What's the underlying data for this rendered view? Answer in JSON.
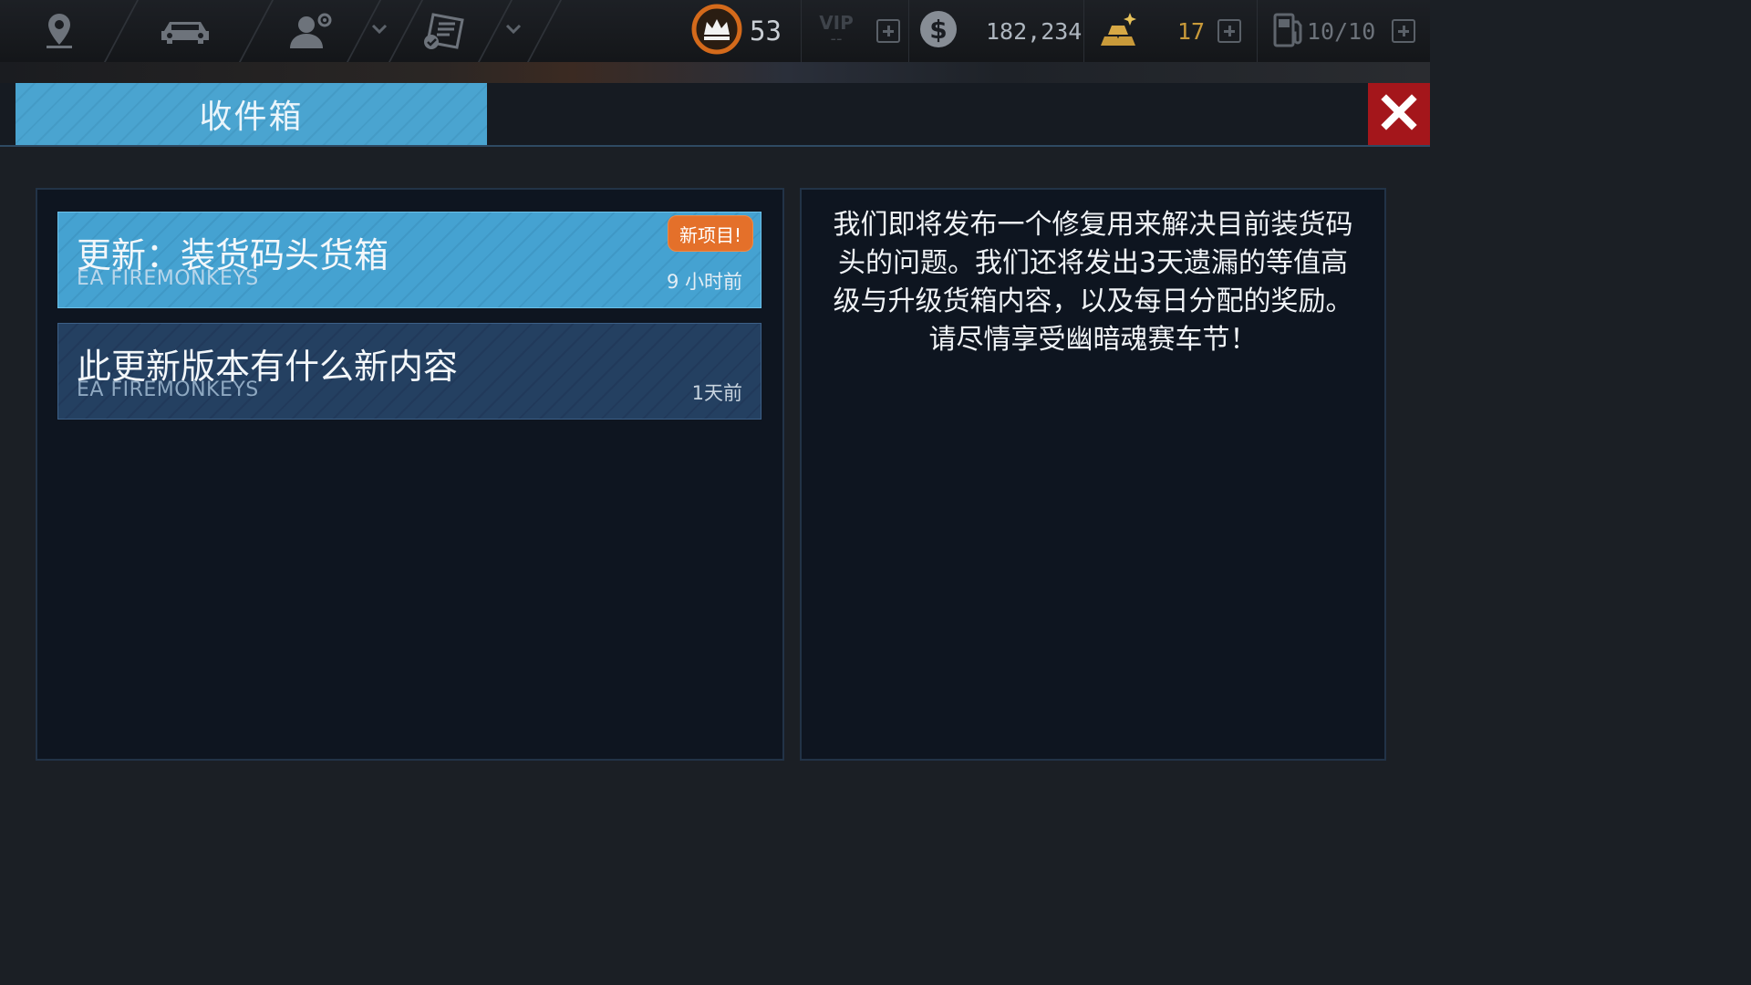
{
  "topbar": {
    "nav_icons": [
      "location-pin-icon",
      "car-icon",
      "profile-settings-icon",
      "checklist-icon"
    ],
    "rank": {
      "icon": "crown-icon",
      "value": "53"
    },
    "vip": {
      "label": "VIP",
      "value": "--"
    },
    "cash": {
      "icon": "dollar-coin-icon",
      "value": "182,234"
    },
    "gold": {
      "icon": "gold-bars-icon",
      "value": "17"
    },
    "fuel": {
      "icon": "fuel-pump-icon",
      "value": "10/10"
    }
  },
  "header": {
    "tab_label": "收件箱",
    "close_icon": "close-x-icon",
    "close_color": "#a4161b"
  },
  "messages": [
    {
      "title": "更新：装货码头货箱",
      "sender": "EA FIREMONKEYS",
      "time": "9 小时前",
      "badge": "新项目!",
      "selected": true
    },
    {
      "title": "此更新版本有什么新内容",
      "sender": "EA FIREMONKEYS",
      "time": "1天前",
      "badge": "",
      "selected": false
    }
  ],
  "detail": {
    "body": "我们即将发布一个修复用来解决目前装货码头的问题。我们还将发出3天遗漏的等值高级与升级货箱内容，以及每日分配的奖励。请尽情享受幽暗魂赛车节！"
  },
  "colors": {
    "accent_blue": "#4aa4d0",
    "badge_orange": "#e4702a",
    "gold_text": "#c99a3a"
  }
}
